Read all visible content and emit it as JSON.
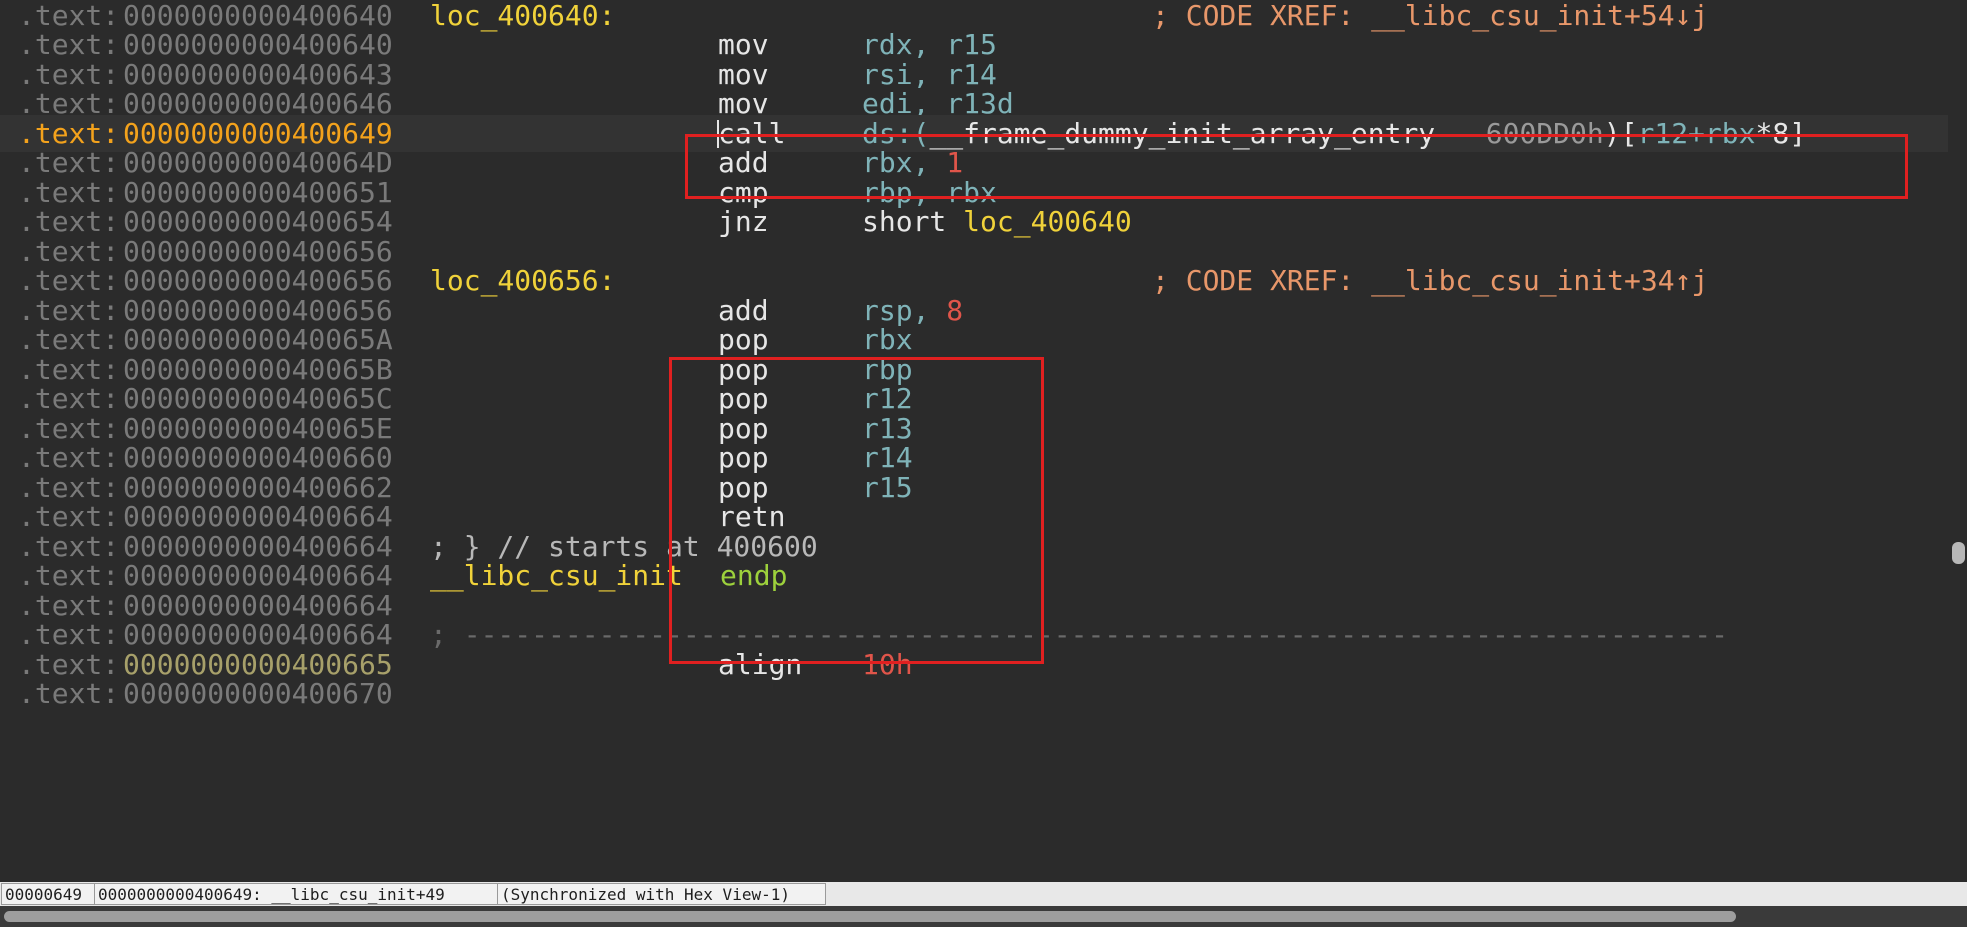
{
  "lines": [
    {
      "seg": ".text:",
      "addr": "0000000000400640",
      "label": "loc_400640:",
      "comment": "; CODE XREF: __libc_csu_init+54↓j"
    },
    {
      "seg": ".text:",
      "addr": "0000000000400640",
      "mnem": "mov",
      "ops": "rdx, r15"
    },
    {
      "seg": ".text:",
      "addr": "0000000000400643",
      "mnem": "mov",
      "ops": "rsi, r14"
    },
    {
      "seg": ".text:",
      "addr": "0000000000400646",
      "mnem": "mov",
      "ops": "edi, r13d"
    },
    {
      "seg": ".text:",
      "addr": "0000000000400649",
      "mnem": "call",
      "ops_a": "ds:(",
      "ops_b": "__frame_dummy_init_array_entry",
      "ops_c": " - ",
      "ops_d": "600DD0h",
      "ops_e": ")[",
      "ops_f": "r12+rbx",
      "ops_g": "*8]"
    },
    {
      "seg": ".text:",
      "addr": "000000000040064D",
      "mnem": "add",
      "ops_a": "rbx, ",
      "ops_b": "1"
    },
    {
      "seg": ".text:",
      "addr": "0000000000400651",
      "mnem": "cmp",
      "ops": "rbp, rbx"
    },
    {
      "seg": ".text:",
      "addr": "0000000000400654",
      "mnem": "jnz",
      "ops_a": "short ",
      "ops_b": "loc_400640"
    },
    {
      "seg": ".text:",
      "addr": "0000000000400656"
    },
    {
      "seg": ".text:",
      "addr": "0000000000400656",
      "label": "loc_400656:",
      "comment": "; CODE XREF: __libc_csu_init+34↑j"
    },
    {
      "seg": ".text:",
      "addr": "0000000000400656",
      "mnem": "add",
      "ops_a": "rsp, ",
      "ops_b": "8"
    },
    {
      "seg": ".text:",
      "addr": "000000000040065A",
      "mnem": "pop",
      "ops": "rbx"
    },
    {
      "seg": ".text:",
      "addr": "000000000040065B",
      "mnem": "pop",
      "ops": "rbp"
    },
    {
      "seg": ".text:",
      "addr": "000000000040065C",
      "mnem": "pop",
      "ops": "r12"
    },
    {
      "seg": ".text:",
      "addr": "000000000040065E",
      "mnem": "pop",
      "ops": "r13"
    },
    {
      "seg": ".text:",
      "addr": "0000000000400660",
      "mnem": "pop",
      "ops": "r14"
    },
    {
      "seg": ".text:",
      "addr": "0000000000400662",
      "mnem": "pop",
      "ops": "r15"
    },
    {
      "seg": ".text:",
      "addr": "0000000000400664",
      "mnem": "retn"
    },
    {
      "seg": ".text:",
      "addr": "0000000000400664",
      "text": "; } // starts at 400600"
    },
    {
      "seg": ".text:",
      "addr": "0000000000400664",
      "endp_name": "__libc_csu_init",
      "endp_kw": "endp"
    },
    {
      "seg": ".text:",
      "addr": "0000000000400664"
    },
    {
      "seg": ".text:",
      "addr": "0000000000400664",
      "sep": "; ---------------------------------------------------------------------------"
    },
    {
      "seg": ".text:",
      "addr": "0000000000400665",
      "mnem": "align",
      "ops_num": "10h"
    },
    {
      "seg": ".text:",
      "addr": "0000000000400670"
    }
  ],
  "status": {
    "offset": "00000649",
    "location": "0000000000400649: __libc_csu_init+49",
    "sync": "(Synchronized with Hex View-1)"
  },
  "colors": {
    "highlight_box": "#e02020",
    "current_address": "#f3a21c",
    "label": "#f0d23a",
    "register": "#7fb3b8",
    "number": "#e0554a",
    "comment": "#e8976a"
  }
}
